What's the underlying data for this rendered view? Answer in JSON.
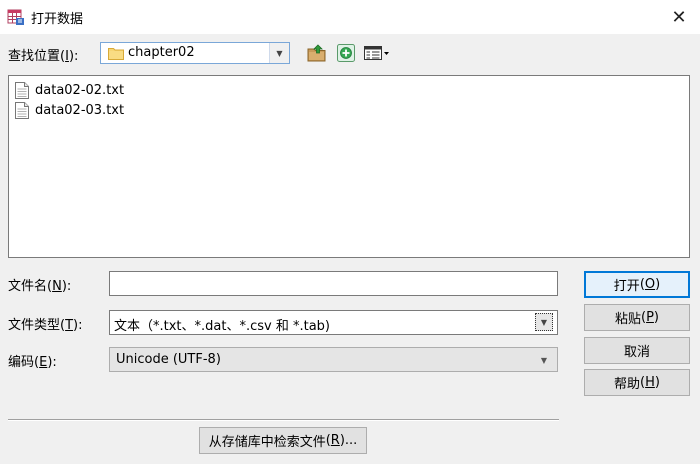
{
  "window": {
    "title": "打开数据",
    "close_glyph": "✕"
  },
  "look_in": {
    "label": "查找位置",
    "accesskey": "I",
    "value": "chapter02"
  },
  "files": [
    {
      "name": "data02-02.txt",
      "icon": "text-file-icon"
    },
    {
      "name": "data02-03.txt",
      "icon": "text-file-icon"
    }
  ],
  "filename": {
    "label": "文件名",
    "accesskey": "N",
    "value": ""
  },
  "filetype": {
    "label": "文件类型",
    "accesskey": "T",
    "value": "文本（*.txt、*.dat、*.csv 和 *.tab)"
  },
  "encoding": {
    "label": "编码",
    "accesskey": "E",
    "value": "Unicode (UTF-8)"
  },
  "buttons": {
    "open": {
      "label": "打开",
      "accesskey": "O"
    },
    "paste": {
      "label": "粘贴",
      "accesskey": "P"
    },
    "cancel": {
      "label": "取消"
    },
    "help": {
      "label": "帮助",
      "accesskey": "H"
    },
    "retrieve": {
      "label": "从存储库中检索文件",
      "accesskey": "R",
      "suffix": "..."
    }
  },
  "colors": {
    "default_button_border": "#0078d7",
    "dialog_background": "#f0f0f0",
    "combo_focus_border": "#7aa7d8"
  }
}
